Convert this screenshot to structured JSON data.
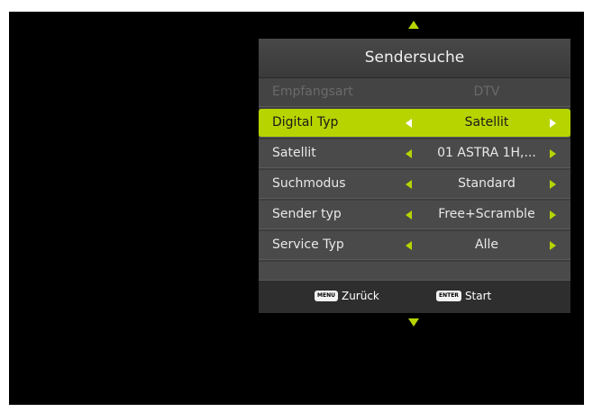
{
  "menu": {
    "title": "Sendersuche",
    "rows": [
      {
        "label": "Empfangsart",
        "value": "DTV"
      },
      {
        "label": "Digital Typ",
        "value": "Satellit"
      },
      {
        "label": "Satellit",
        "value": "01 ASTRA 1H,..."
      },
      {
        "label": "Suchmodus",
        "value": "Standard"
      },
      {
        "label": "Sender typ",
        "value": "Free+Scramble"
      },
      {
        "label": "Service Typ",
        "value": "Alle"
      }
    ]
  },
  "footer": {
    "back_key": "MENU",
    "back_label": "Zurück",
    "start_key": "ENTER",
    "start_label": "Start"
  },
  "colors": {
    "accent": "#b7d400",
    "background": "#000000",
    "panel": "#3e3e3e"
  }
}
